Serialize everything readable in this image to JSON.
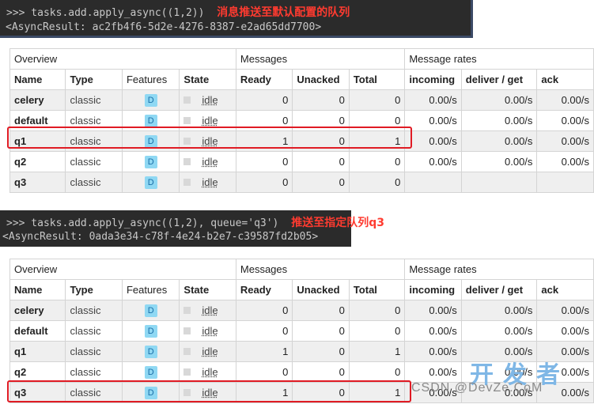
{
  "console1": {
    "line1": ">>> tasks.add.apply_async((1,2))",
    "note": "消息推送至默认配置的队列",
    "line2": "<AsyncResult: ac2fb4f6-5d2e-4276-8387-e2ad65dd7700>"
  },
  "console2": {
    "line1": ">>> tasks.add.apply_async((1,2), queue='q3')",
    "note": "推送至指定队列q3",
    "line2": "<AsyncResult: 0ada3e34-c78f-4e24-b2e7-c39587fd2b05>"
  },
  "table_headers": {
    "overview": "Overview",
    "messages": "Messages",
    "message_rates": "Message rates",
    "name": "Name",
    "type": "Type",
    "features": "Features",
    "state": "State",
    "ready": "Ready",
    "unacked": "Unacked",
    "total": "Total",
    "incoming": "incoming",
    "deliver_get": "deliver / get",
    "ack": "ack"
  },
  "table1": {
    "rows": [
      {
        "name": "celery",
        "type": "classic",
        "features": "D",
        "state": "idle",
        "ready": "0",
        "unacked": "0",
        "total": "0",
        "incoming": "0.00/s",
        "deliver_get": "0.00/s",
        "ack": "0.00/s"
      },
      {
        "name": "default",
        "type": "classic",
        "features": "D",
        "state": "idle",
        "ready": "0",
        "unacked": "0",
        "total": "0",
        "incoming": "0.00/s",
        "deliver_get": "0.00/s",
        "ack": "0.00/s"
      },
      {
        "name": "q1",
        "type": "classic",
        "features": "D",
        "state": "idle",
        "ready": "1",
        "unacked": "0",
        "total": "1",
        "incoming": "0.00/s",
        "deliver_get": "0.00/s",
        "ack": "0.00/s"
      },
      {
        "name": "q2",
        "type": "classic",
        "features": "D",
        "state": "idle",
        "ready": "0",
        "unacked": "0",
        "total": "0",
        "incoming": "0.00/s",
        "deliver_get": "0.00/s",
        "ack": "0.00/s"
      },
      {
        "name": "q3",
        "type": "classic",
        "features": "D",
        "state": "idle",
        "ready": "0",
        "unacked": "0",
        "total": "0",
        "incoming": "",
        "deliver_get": "",
        "ack": ""
      }
    ]
  },
  "table2": {
    "rows": [
      {
        "name": "celery",
        "type": "classic",
        "features": "D",
        "state": "idle",
        "ready": "0",
        "unacked": "0",
        "total": "0",
        "incoming": "0.00/s",
        "deliver_get": "0.00/s",
        "ack": "0.00/s"
      },
      {
        "name": "default",
        "type": "classic",
        "features": "D",
        "state": "idle",
        "ready": "0",
        "unacked": "0",
        "total": "0",
        "incoming": "0.00/s",
        "deliver_get": "0.00/s",
        "ack": "0.00/s"
      },
      {
        "name": "q1",
        "type": "classic",
        "features": "D",
        "state": "idle",
        "ready": "1",
        "unacked": "0",
        "total": "1",
        "incoming": "0.00/s",
        "deliver_get": "0.00/s",
        "ack": "0.00/s"
      },
      {
        "name": "q2",
        "type": "classic",
        "features": "D",
        "state": "idle",
        "ready": "0",
        "unacked": "0",
        "total": "0",
        "incoming": "0.00/s",
        "deliver_get": "0.00/s",
        "ack": "0.00/s"
      },
      {
        "name": "q3",
        "type": "classic",
        "features": "D",
        "state": "idle",
        "ready": "1",
        "unacked": "0",
        "total": "1",
        "incoming": "0.00/s",
        "deliver_get": "0.00/s",
        "ack": "0.00/s"
      }
    ]
  },
  "watermark": {
    "text": "CSDN @DevZe.CoM",
    "logo": "开发者"
  },
  "colors": {
    "console_bg": "#2b2b2b",
    "note_red": "#ff3b30",
    "highlight_red": "#e01b24",
    "badge_bg": "#8fd8f3"
  }
}
